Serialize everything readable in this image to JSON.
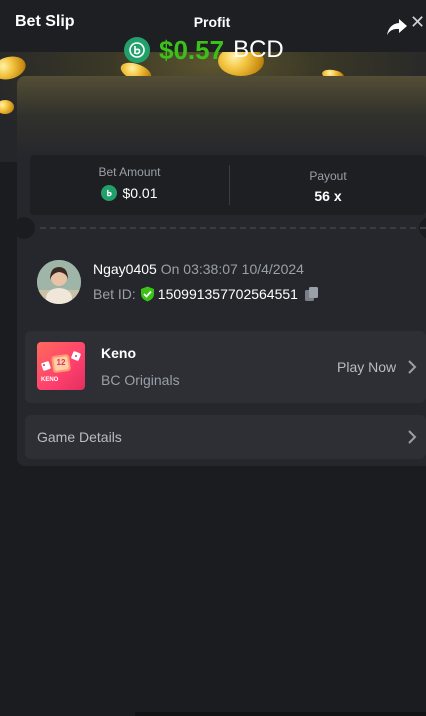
{
  "header": {
    "title": "Bet Slip"
  },
  "profit": {
    "label": "Profit",
    "value": "$0.57",
    "currency": "BCD"
  },
  "bet_amount": {
    "label": "Bet Amount",
    "value": "$0.01"
  },
  "payout": {
    "label": "Payout",
    "value": "56 x"
  },
  "user": {
    "name": "Ngay0405",
    "on_text": "On 03:38:07 10/4/2024",
    "bet_id_label": "Bet ID:",
    "bet_id": "150991357702564551"
  },
  "game": {
    "name": "Keno",
    "provider": "BC Originals",
    "play_label": "Play Now",
    "thumb_badge": "12",
    "thumb_text": "KENO"
  },
  "details": {
    "label": "Game Details"
  },
  "colors": {
    "accent_green": "#3bc117",
    "bc_green": "#22a06b",
    "card_bg": "#26272c"
  },
  "icons": [
    "close-icon",
    "share-icon",
    "bc-coin-icon",
    "shield-check-icon",
    "copy-icon",
    "chevron-right-icon"
  ]
}
